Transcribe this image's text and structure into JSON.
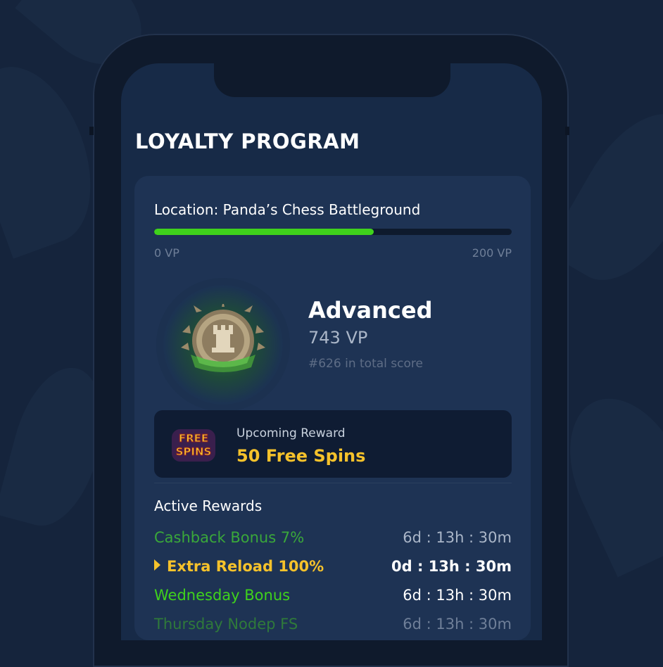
{
  "page": {
    "title": "LOYALTY PROGRAM"
  },
  "location": {
    "label": "Location: Panda’s Chess Battleground",
    "progress_fraction": 0.615,
    "min_label": "0 VP",
    "max_label": "200 VP"
  },
  "level": {
    "name": "Advanced",
    "points": "743 VP",
    "rank": "#626 in total score"
  },
  "upcoming": {
    "label": "Upcoming Reward",
    "value": "50 Free Spins",
    "icon_text_1": "FREE",
    "icon_text_2": "SPINS"
  },
  "active": {
    "title": "Active Rewards",
    "rows": [
      {
        "name": "Cashback Bonus 7%",
        "time": "6d : 13h : 30m",
        "name_color": "#3aa83a",
        "time_color": "#aab6c8",
        "bold": false
      },
      {
        "name": "Extra Reload 100%",
        "time": "0d : 13h : 30m",
        "name_color": "#f6c22b",
        "time_color": "#ffffff",
        "bold": true
      },
      {
        "name": "Wednesday Bonus",
        "time": "6d : 13h : 30m",
        "name_color": "#3fd21c",
        "time_color": "#ffffff",
        "bold": false
      },
      {
        "name": "Thursday Nodep FS",
        "time": "6d : 13h : 30m",
        "name_color": "#2f7a3a",
        "time_color": "#6f7f98",
        "bold": false
      }
    ]
  },
  "colors": {
    "accent_green": "#3fd21c",
    "accent_gold": "#f6c22b",
    "card": "#1e3354"
  }
}
